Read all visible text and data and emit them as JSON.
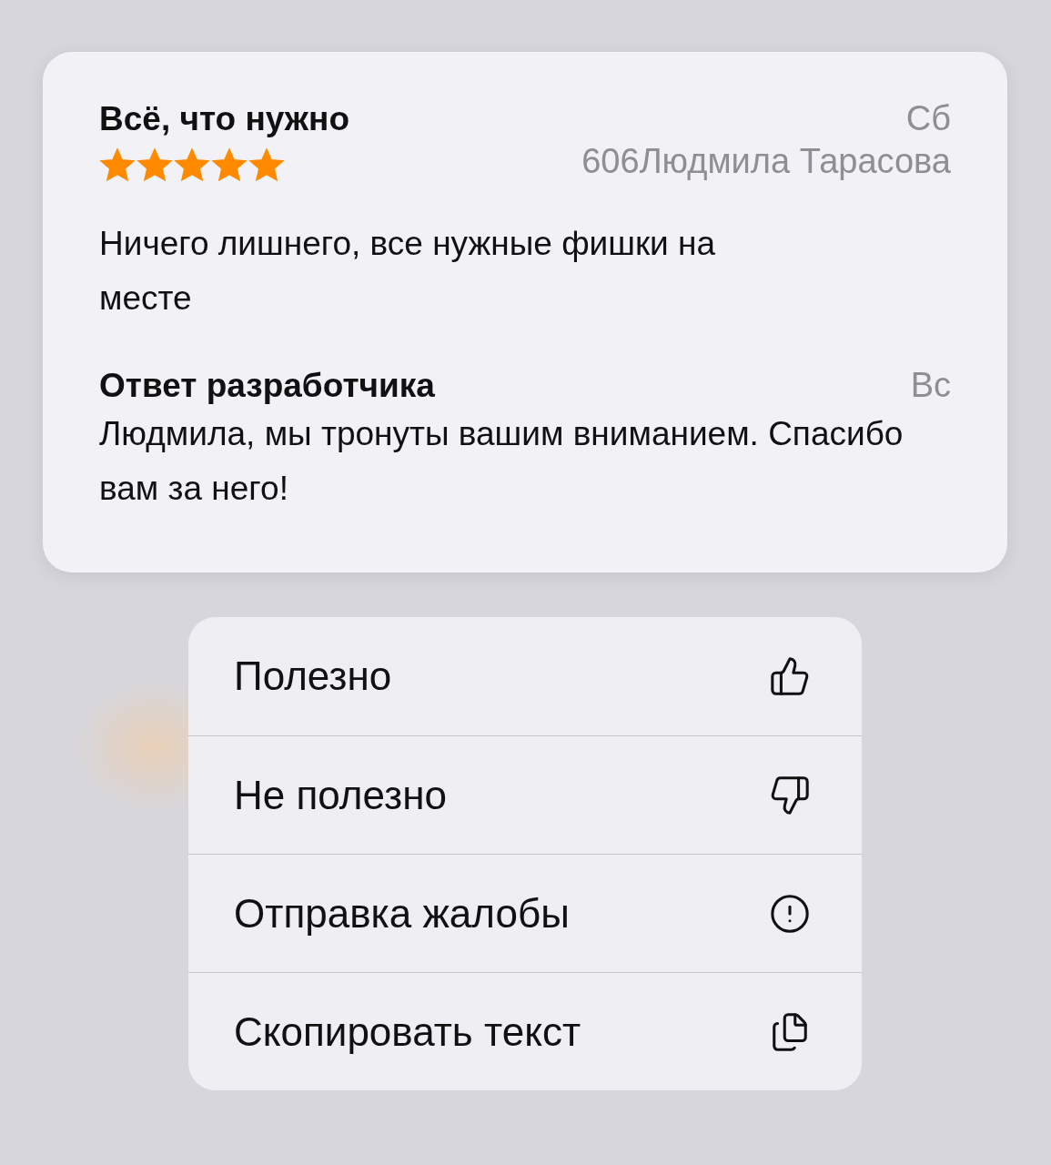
{
  "review": {
    "title": "Всё, что нужно",
    "day": "Сб",
    "stars": 5,
    "author": "606Людмила Тарасова",
    "body": "Ничего лишнего, все нужные фишки на месте"
  },
  "developer_response": {
    "title": "Ответ разработчика",
    "day": "Вс",
    "body": "Людмила, мы тронуты вашим вниманием. Спасибо вам за него!"
  },
  "menu": [
    {
      "label": "Полезно"
    },
    {
      "label": "Не полезно"
    },
    {
      "label": "Отправка жалобы"
    },
    {
      "label": "Скопировать текст"
    }
  ]
}
